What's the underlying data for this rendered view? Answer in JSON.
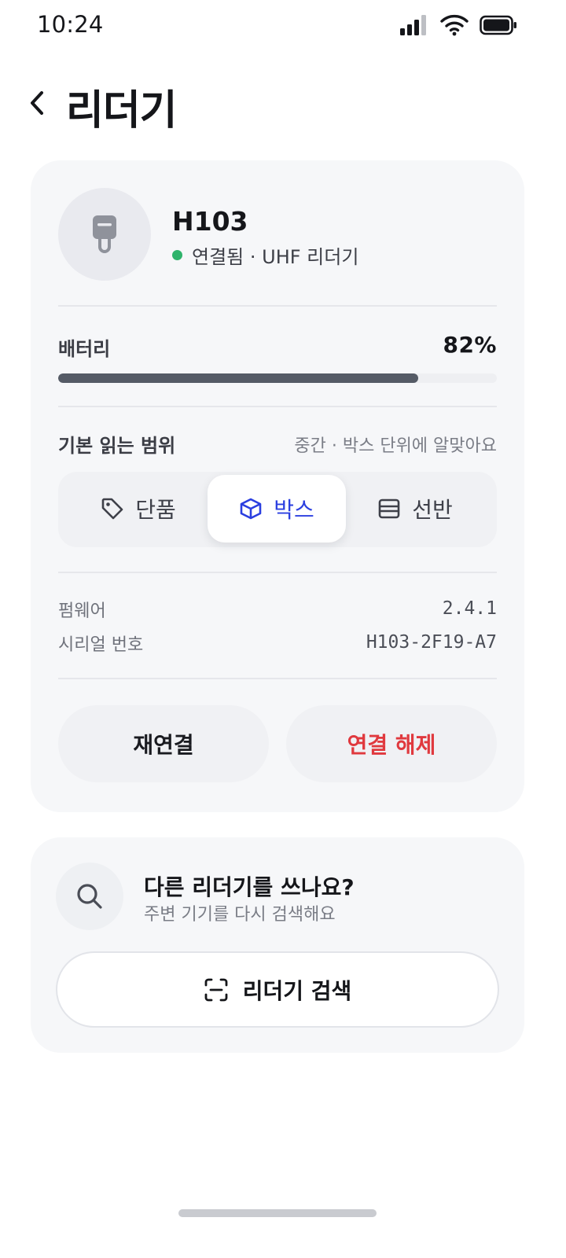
{
  "status_bar": {
    "time": "10:24"
  },
  "header": {
    "title": "리더기"
  },
  "device": {
    "name": "H103",
    "status": "연결됨 · UHF 리더기",
    "status_color": "#2fb36b",
    "battery": {
      "label": "배터리",
      "value_text": "82%",
      "percent": 82
    },
    "range": {
      "label": "기본 읽는 범위",
      "hint": "중간 · 박스 단위에 알맞아요",
      "options": [
        {
          "label": "단품",
          "icon": "tag-icon",
          "selected": false
        },
        {
          "label": "박스",
          "icon": "box-icon",
          "selected": true
        },
        {
          "label": "선반",
          "icon": "shelf-icon",
          "selected": false
        }
      ]
    },
    "info": [
      {
        "label": "펌웨어",
        "value": "2.4.1"
      },
      {
        "label": "시리얼 번호",
        "value": "H103-2F19-A7"
      }
    ],
    "actions": {
      "reconnect": "재연결",
      "disconnect": "연결 해제"
    }
  },
  "search": {
    "title": "다른 리더기를 쓰나요?",
    "subtitle": "주변 기기를 다시 검색해요",
    "button": "리더기 검색"
  },
  "colors": {
    "accent": "#2b3fe0",
    "danger": "#e0393e",
    "card_bg": "#f6f7f9"
  }
}
